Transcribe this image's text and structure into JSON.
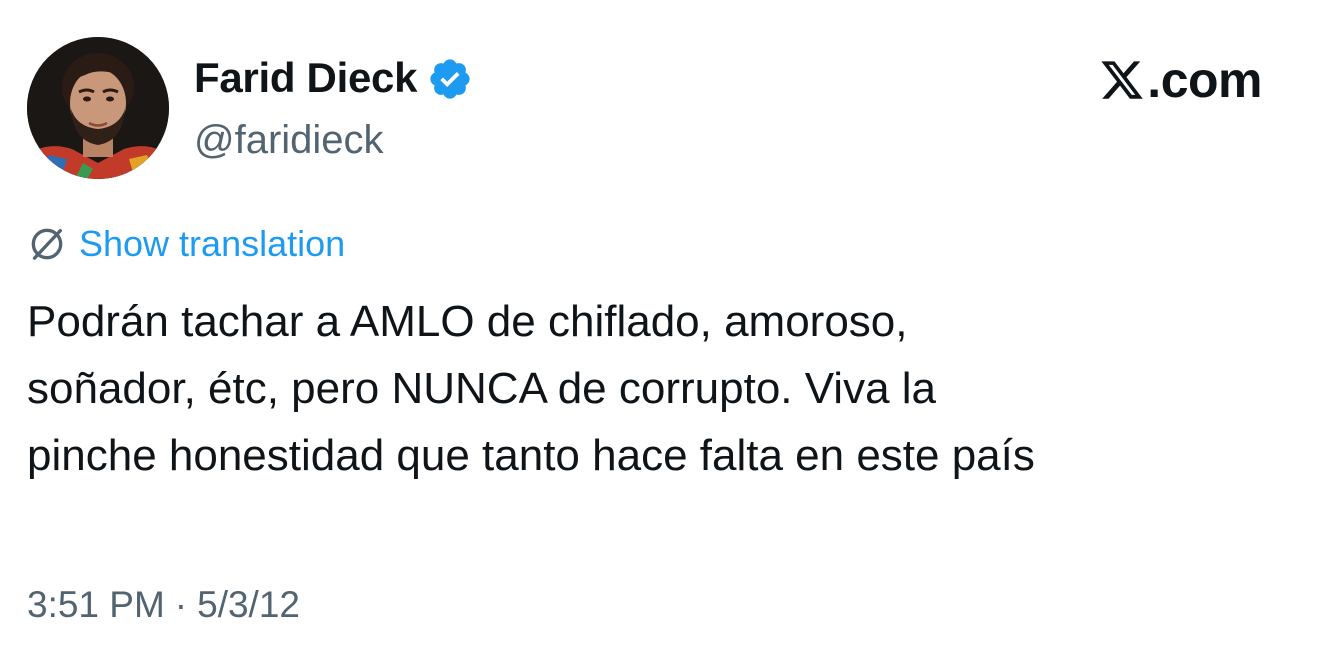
{
  "author": {
    "display_name": "Farid Dieck",
    "handle": "@faridieck",
    "verified": true,
    "avatar_icon": "user-avatar-photo"
  },
  "brand": {
    "logo_icon": "x-logo-icon",
    "text": ".com"
  },
  "translation": {
    "icon": "globe-icon",
    "label": "Show translation"
  },
  "tweet": {
    "lines": [
      "Podrán tachar a AMLO de chiflado, amoroso,",
      "soñador, étc, pero NUNCA de corrupto. Viva la",
      "pinche honestidad que tanto hace falta en este país"
    ]
  },
  "meta": {
    "time": "3:51 PM",
    "separator": "·",
    "date": "5/3/12"
  },
  "colors": {
    "text": "#0f1419",
    "secondary": "#536471",
    "accent": "#1d9bf0"
  }
}
